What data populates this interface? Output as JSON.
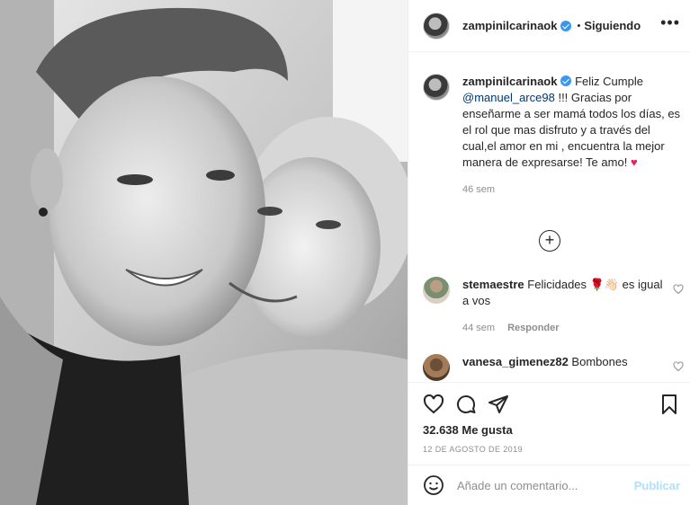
{
  "header": {
    "username": "zampinilcarinaok",
    "separator": "•",
    "follow_status": "Siguiendo",
    "more_icon": "more-horizontal-icon"
  },
  "caption": {
    "username": "zampinilcarinaok",
    "text_before": "Feliz Cumple",
    "mention": "@manuel_arce98",
    "text_after": "!!! Gracias por enseñarme a ser mamá todos los días, es el rol que mas disfruto y a través del cual,el amor en mi , encuentra la mejor manera de expresarse! Te amo!",
    "emoji": "♥",
    "time": "46 sem"
  },
  "load_more_icon": "plus-circle-icon",
  "comments": [
    {
      "username": "stemaestre",
      "text_before": "Felicidades",
      "emoji": "🌹👋🏻",
      "text_after": "es igual a vos",
      "time": "44 sem",
      "reply": "Responder"
    },
    {
      "username": "vanesa_gimenez82",
      "text": "Bombones"
    }
  ],
  "actions": {
    "icons": [
      "heart-icon",
      "comment-icon",
      "share-icon",
      "bookmark-icon"
    ],
    "likes": "32.638 Me gusta",
    "date": "12 DE AGOSTO DE 2019"
  },
  "add_comment": {
    "placeholder": "Añade un comentario...",
    "publish_label": "Publicar"
  },
  "colors": {
    "link": "#00376b",
    "verified": "#3897f0",
    "muted": "#8e8e8e",
    "publish_disabled": "#b2dffc"
  }
}
